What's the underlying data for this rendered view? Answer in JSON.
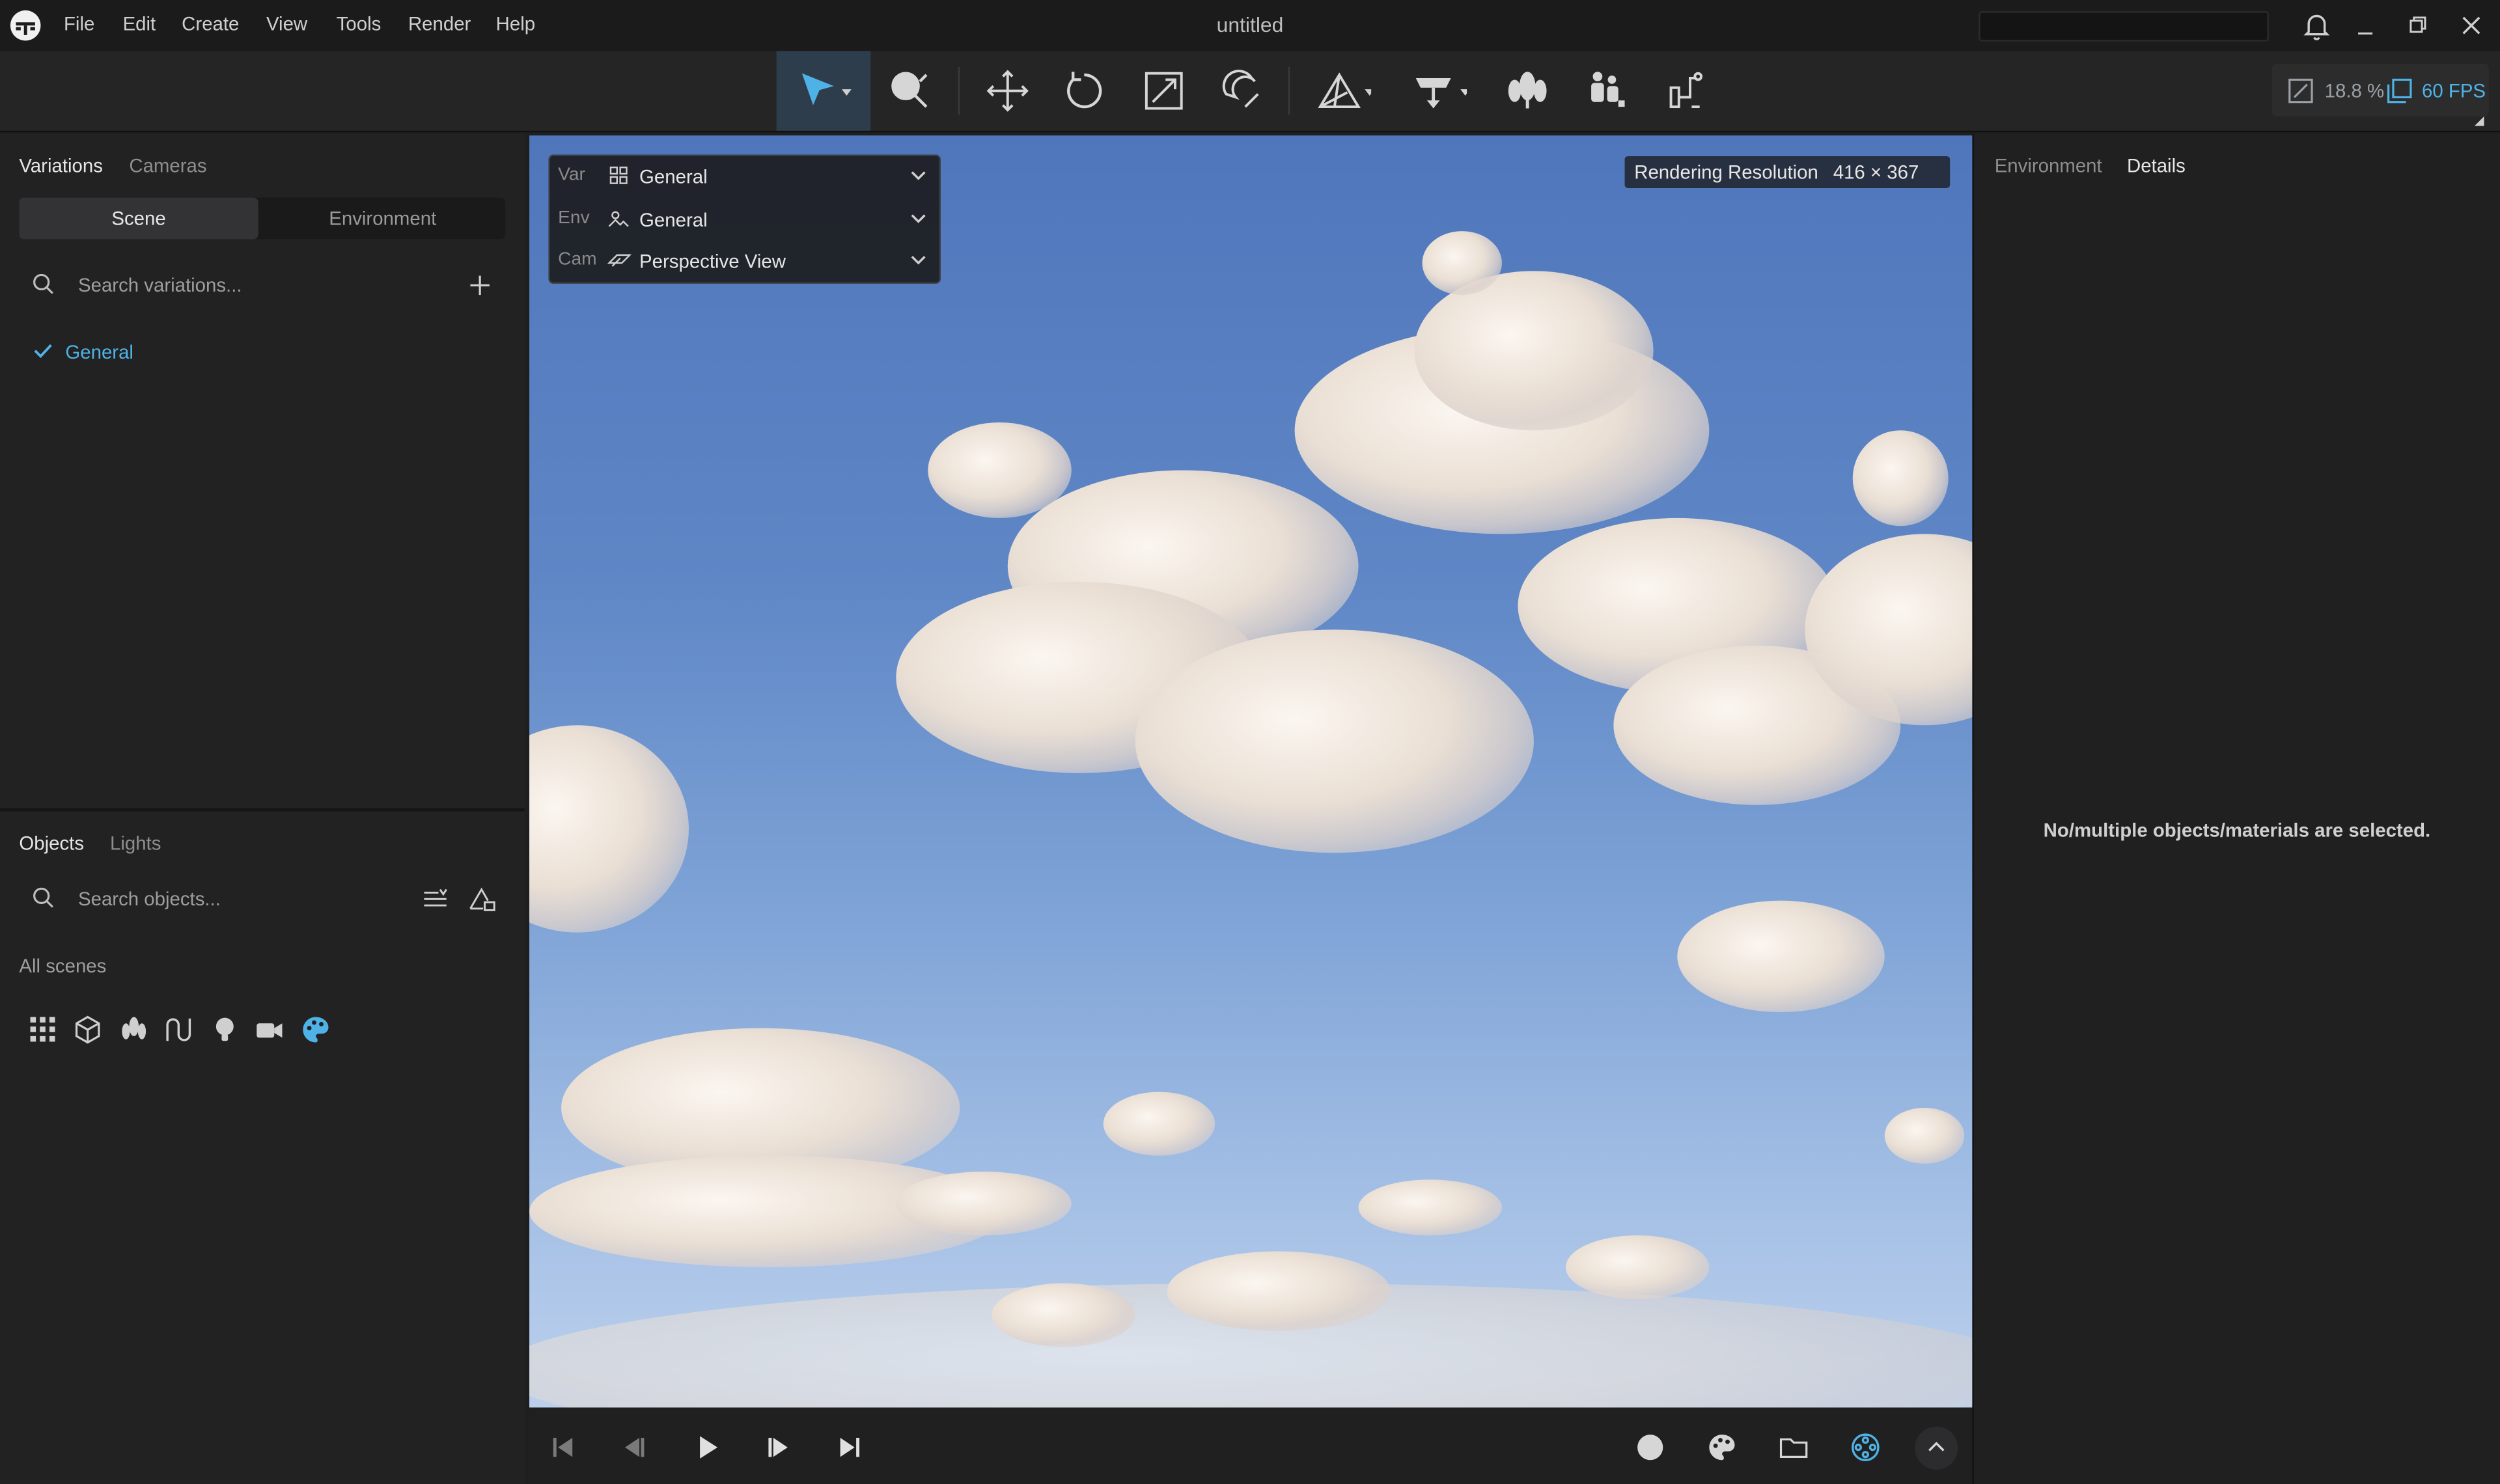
{
  "app": {
    "title": "untitled"
  },
  "menu": {
    "items": [
      "File",
      "Edit",
      "Create",
      "View",
      "Tools",
      "Render",
      "Help"
    ]
  },
  "toolbar": {
    "tools": [
      "select-arrow-icon",
      "material-picker-icon",
      "move-icon",
      "rotate-icon",
      "scale-icon",
      "snap-icon",
      "add-geometry-icon",
      "add-light-icon",
      "vegetation-icon",
      "people-icon",
      "constraint-icon"
    ],
    "zoom": "18.8 %",
    "fps": "60 FPS",
    "accent": "#4fb2e6"
  },
  "left_panel": {
    "top_tabs": [
      "Variations",
      "Cameras"
    ],
    "segment": {
      "scene": "Scene",
      "environment": "Environment"
    },
    "search_variations": "Search variations...",
    "variations": [
      {
        "label": "General",
        "checked": true
      }
    ],
    "bottom_tabs": [
      "Objects",
      "Lights"
    ],
    "search_objects": "Search objects...",
    "scope": "All scenes",
    "object_filters": [
      "grid-icon",
      "cube-icon",
      "vegetation-icon",
      "curve-icon",
      "bulb-icon",
      "camera-icon",
      "palette-icon"
    ]
  },
  "viewport": {
    "overlay": {
      "var_label": "Var",
      "var_value": "General",
      "env_label": "Env",
      "env_value": "General",
      "cam_label": "Cam",
      "cam_value": "Perspective View"
    },
    "resolution_label": "Rendering Resolution",
    "resolution_value": "416 × 367"
  },
  "bottom_bar": {
    "playback": [
      "skip-start-icon",
      "step-back-icon",
      "play-icon",
      "step-forward-icon",
      "skip-end-icon"
    ],
    "right_icons": [
      "sphere-icon",
      "palette-icon",
      "folder-icon",
      "film-reel-icon",
      "chevron-up-icon"
    ]
  },
  "right_panel": {
    "tabs": [
      "Environment",
      "Details"
    ],
    "message": "No/multiple objects/materials are selected."
  }
}
